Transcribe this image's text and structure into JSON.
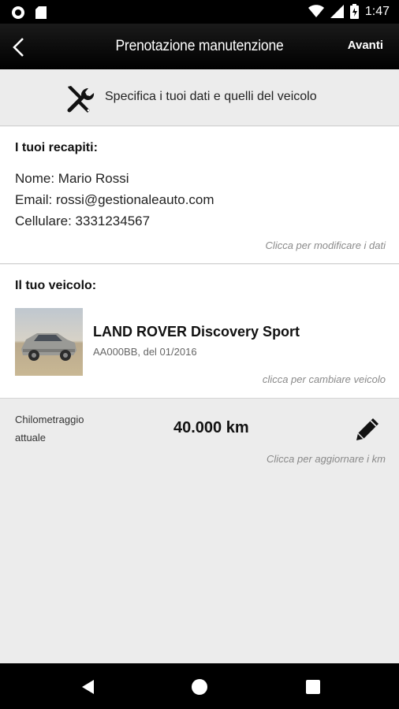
{
  "status_bar": {
    "time": "1:47"
  },
  "app_bar": {
    "title": "Prenotazione manutenzione",
    "next_label": "Avanti"
  },
  "banner": {
    "text": "Specifica i tuoi dati e quelli del veicolo"
  },
  "contacts": {
    "title": "I tuoi recapiti:",
    "name": "Nome: Mario Rossi",
    "email": "Email: rossi@gestionaleauto.com",
    "phone": "Cellulare: 3331234567",
    "edit_hint": "Clicca per modificare i dati"
  },
  "vehicle": {
    "title": "Il tuo veicolo:",
    "name": "LAND ROVER Discovery Sport",
    "details": "AA000BB, del 01/2016",
    "change_hint": "clicca per cambiare veicolo"
  },
  "mileage": {
    "label": "Chilometraggio attuale",
    "value": "40.000 km",
    "update_hint": "Clicca per aggiornare i km"
  }
}
